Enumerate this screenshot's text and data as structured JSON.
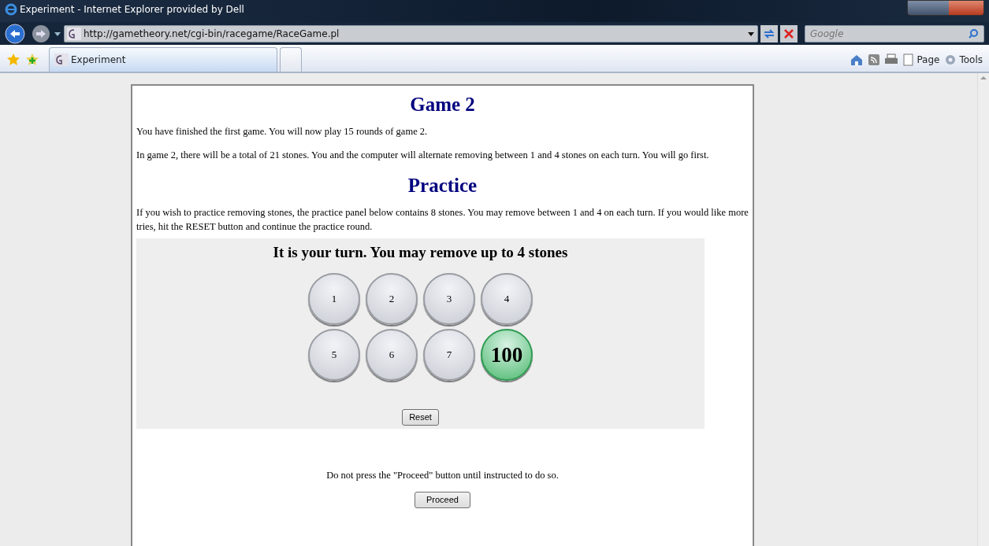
{
  "window": {
    "title": "Experiment - Internet Explorer provided by Dell"
  },
  "address_bar": {
    "url": "http://gametheory.net/cgi-bin/racegame/RaceGame.pl"
  },
  "search": {
    "placeholder": "Google"
  },
  "tabs": [
    {
      "label": "Experiment",
      "selected": true
    },
    {
      "selected": false
    }
  ],
  "command_bar": [
    "Page",
    "Tools"
  ],
  "page": {
    "heading": "Game 2",
    "paragraphs": [
      "You have finished the first game. You will now play 15 rounds of game 2.",
      "In game 2, there will be a total of 21 stones. You and the computer will alternate removing between 1 and 4 stones on each turn. You will go first."
    ],
    "practice_heading": "Practice",
    "practice_text": "If you wish to practice removing stones, the practice panel below contains 8 stones. You may remove between 1 and 4 on each turn. If you would like more tries, hit the RESET button and continue the practice round.",
    "panel": {
      "status": "It is your turn. You may remove up to 4 stones",
      "stones": [
        {
          "label": "1",
          "kind": "stone"
        },
        {
          "label": "2",
          "kind": "stone"
        },
        {
          "label": "3",
          "kind": "stone"
        },
        {
          "label": "4",
          "kind": "stone"
        },
        {
          "label": "5",
          "kind": "stone"
        },
        {
          "label": "6",
          "kind": "stone"
        },
        {
          "label": "7",
          "kind": "stone"
        },
        {
          "label": "100",
          "kind": "goal"
        }
      ],
      "reset_button": "Reset"
    },
    "notice": "Do not press the \"Proceed\" button until instructed to do so.",
    "proceed_button": "Proceed"
  }
}
